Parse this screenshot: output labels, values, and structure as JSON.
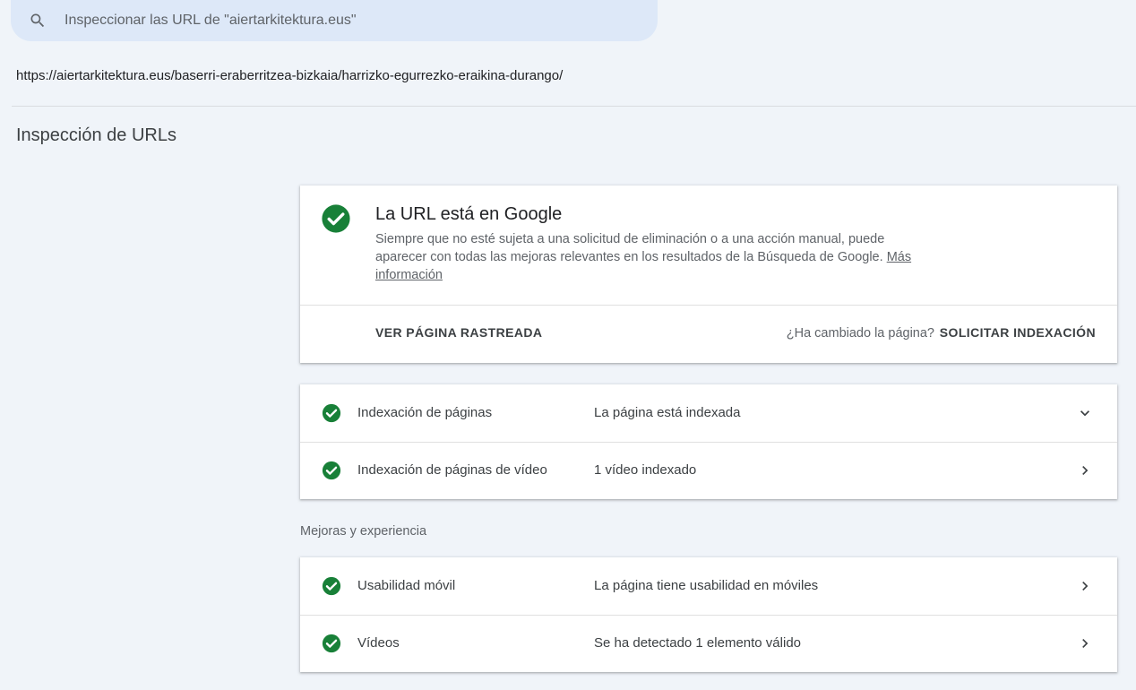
{
  "search": {
    "placeholder": "Inspeccionar las URL de \"aiertarkitektura.eus\""
  },
  "inspected_url": "https://aiertarkitektura.eus/baserri-eraberritzea-bizkaia/harrizko-egurrezko-eraikina-durango/",
  "page_title": "Inspección de URLs",
  "status_card": {
    "title": "La URL está en Google",
    "description": "Siempre que no esté sujeta a una solicitud de eliminación o a una acción manual, puede aparecer con todas las mejoras relevantes en los resultados de la Búsqueda de Google.",
    "learn_more": "Más información",
    "view_crawled": "VER PÁGINA RASTREADA",
    "changed_question": "¿Ha cambiado la página?",
    "request_indexing": "SOLICITAR INDEXACIÓN"
  },
  "indexing": {
    "rows": [
      {
        "label": "Indexación de páginas",
        "value": "La página está indexada",
        "chevron": "chevron-down-icon"
      },
      {
        "label": "Indexación de páginas de vídeo",
        "value": "1 vídeo indexado",
        "chevron": "chevron-right-icon"
      }
    ]
  },
  "enhancements": {
    "section_label": "Mejoras y experiencia",
    "rows": [
      {
        "label": "Usabilidad móvil",
        "value": "La página tiene usabilidad en móviles",
        "chevron": "chevron-right-icon"
      },
      {
        "label": "Vídeos",
        "value": "Se ha detectado 1 elemento válido",
        "chevron": "chevron-right-icon"
      }
    ]
  },
  "colors": {
    "success_green": "#188038",
    "background": "#f0f4f9",
    "search_bg": "#dde8f8"
  }
}
